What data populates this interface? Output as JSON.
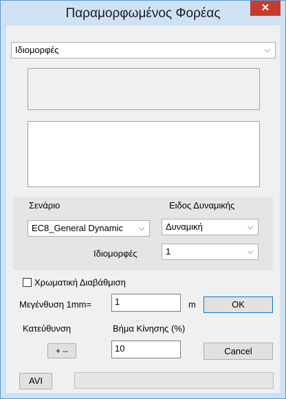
{
  "window": {
    "title": "Παραμορφωμένος Φορέας",
    "close_glyph": "✕"
  },
  "mode_select": {
    "value": "Ιδιομορφές"
  },
  "scenario": {
    "label": "Σενάριο",
    "value": "EC8_General Dynamic"
  },
  "dynamic_type": {
    "label": "Ειδος Δυναμικής",
    "value": "Δυναμική"
  },
  "modes": {
    "label": "Ιδιομορφές",
    "value": "1"
  },
  "color_scale": {
    "label": "Χρωματική Διαβάθμιση",
    "checked": false
  },
  "magnification": {
    "label": "Μεγένθυση 1mm=",
    "value": "1",
    "unit": "m"
  },
  "ok_button": {
    "label": "OK"
  },
  "direction": {
    "label": "Κατεύθυνση",
    "button_label": "+ --"
  },
  "step": {
    "label": "Βήμα Κίνησης (%)",
    "value": "10"
  },
  "cancel_button": {
    "label": "Cancel"
  },
  "avi_button": {
    "label": "AVI"
  },
  "icons": {
    "dropdown": "chevron-down-icon",
    "close": "close-icon"
  },
  "colors": {
    "title_bar": "#cfe1f5",
    "close_button": "#c53b2c",
    "dialog_bg": "#f0f0f0"
  }
}
